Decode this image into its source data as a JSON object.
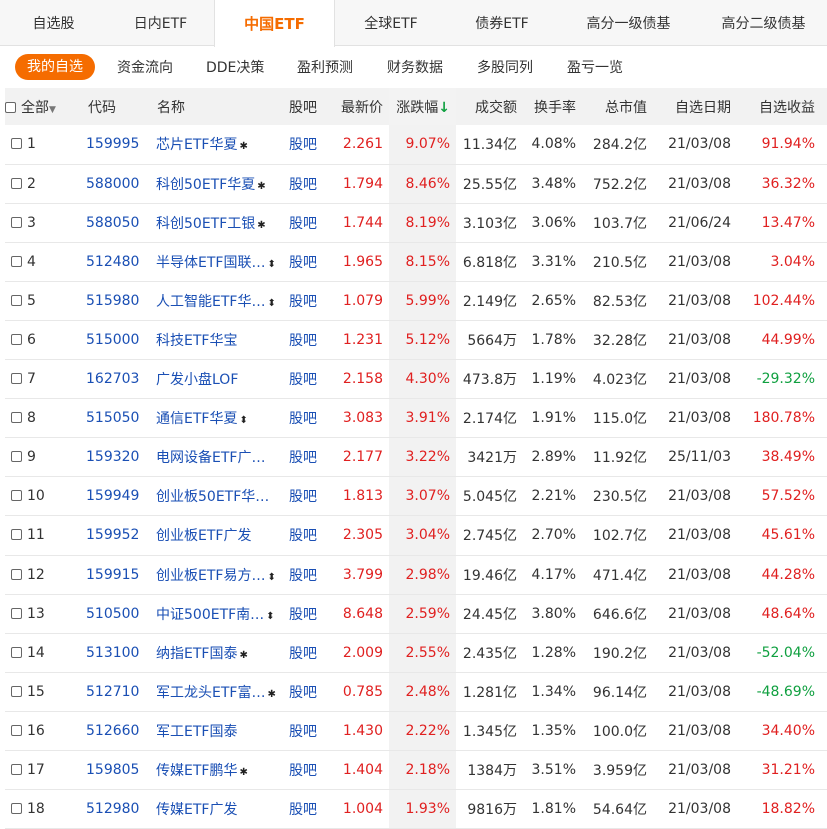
{
  "tabs": [
    {
      "label": "自选股"
    },
    {
      "label": "日内ETF"
    },
    {
      "label": "中国ETF"
    },
    {
      "label": "全球ETF"
    },
    {
      "label": "债券ETF"
    },
    {
      "label": "高分一级债基"
    },
    {
      "label": "高分二级债基"
    }
  ],
  "active_tab": "中国ETF",
  "subnav": [
    {
      "label": "我的自选"
    },
    {
      "label": "资金流向"
    },
    {
      "label": "DDE决策"
    },
    {
      "label": "盈利预测"
    },
    {
      "label": "财务数据"
    },
    {
      "label": "多股同列"
    },
    {
      "label": "盈亏一览"
    }
  ],
  "header": {
    "all": "全部",
    "all_caret": "▼",
    "code": "代码",
    "name": "名称",
    "bar": "股吧",
    "price": "最新价",
    "change": "涨跌幅",
    "sort_arrow": "↓",
    "turnover": "成交额",
    "rate": "换手率",
    "cap": "总市值",
    "date": "自选日期",
    "gain": "自选收益"
  },
  "rows": [
    {
      "idx": "1",
      "code": "159995",
      "name": "芯片ETF华夏",
      "mark": "✱",
      "bar": "股吧",
      "price": "2.261",
      "change": "9.07%",
      "turnover": "11.34亿",
      "rate": "4.08%",
      "cap": "284.2亿",
      "date": "21/03/08",
      "gain": "91.94%",
      "gain_dir": "up"
    },
    {
      "idx": "2",
      "code": "588000",
      "name": "科创50ETF华夏",
      "mark": "✱",
      "bar": "股吧",
      "price": "1.794",
      "change": "8.46%",
      "turnover": "25.55亿",
      "rate": "3.48%",
      "cap": "752.2亿",
      "date": "21/03/08",
      "gain": "36.32%",
      "gain_dir": "up"
    },
    {
      "idx": "3",
      "code": "588050",
      "name": "科创50ETF工银",
      "mark": "✱",
      "bar": "股吧",
      "price": "1.744",
      "change": "8.19%",
      "turnover": "3.103亿",
      "rate": "3.06%",
      "cap": "103.7亿",
      "date": "21/06/24",
      "gain": "13.47%",
      "gain_dir": "up"
    },
    {
      "idx": "4",
      "code": "512480",
      "name": "半导体ETF国联…",
      "mark": "⬍",
      "bar": "股吧",
      "price": "1.965",
      "change": "8.15%",
      "turnover": "6.818亿",
      "rate": "3.31%",
      "cap": "210.5亿",
      "date": "21/03/08",
      "gain": "3.04%",
      "gain_dir": "up"
    },
    {
      "idx": "5",
      "code": "515980",
      "name": "人工智能ETF华…",
      "mark": "⬍",
      "bar": "股吧",
      "price": "1.079",
      "change": "5.99%",
      "turnover": "2.149亿",
      "rate": "2.65%",
      "cap": "82.53亿",
      "date": "21/03/08",
      "gain": "102.44%",
      "gain_dir": "up"
    },
    {
      "idx": "6",
      "code": "515000",
      "name": "科技ETF华宝",
      "mark": "",
      "bar": "股吧",
      "price": "1.231",
      "change": "5.12%",
      "turnover": "5664万",
      "rate": "1.78%",
      "cap": "32.28亿",
      "date": "21/03/08",
      "gain": "44.99%",
      "gain_dir": "up"
    },
    {
      "idx": "7",
      "code": "162703",
      "name": "广发小盘LOF",
      "mark": "",
      "bar": "股吧",
      "price": "2.158",
      "change": "4.30%",
      "turnover": "473.8万",
      "rate": "1.19%",
      "cap": "4.023亿",
      "date": "21/03/08",
      "gain": "-29.32%",
      "gain_dir": "down"
    },
    {
      "idx": "8",
      "code": "515050",
      "name": "通信ETF华夏",
      "mark": "⬍",
      "bar": "股吧",
      "price": "3.083",
      "change": "3.91%",
      "turnover": "2.174亿",
      "rate": "1.91%",
      "cap": "115.0亿",
      "date": "21/03/08",
      "gain": "180.78%",
      "gain_dir": "up"
    },
    {
      "idx": "9",
      "code": "159320",
      "name": "电网设备ETF广…",
      "mark": "",
      "bar": "股吧",
      "price": "2.177",
      "change": "3.22%",
      "turnover": "3421万",
      "rate": "2.89%",
      "cap": "11.92亿",
      "date": "25/11/03",
      "gain": "38.49%",
      "gain_dir": "up"
    },
    {
      "idx": "10",
      "code": "159949",
      "name": "创业板50ETF华…",
      "mark": "",
      "bar": "股吧",
      "price": "1.813",
      "change": "3.07%",
      "turnover": "5.045亿",
      "rate": "2.21%",
      "cap": "230.5亿",
      "date": "21/03/08",
      "gain": "57.52%",
      "gain_dir": "up"
    },
    {
      "idx": "11",
      "code": "159952",
      "name": "创业板ETF广发",
      "mark": "",
      "bar": "股吧",
      "price": "2.305",
      "change": "3.04%",
      "turnover": "2.745亿",
      "rate": "2.70%",
      "cap": "102.7亿",
      "date": "21/03/08",
      "gain": "45.61%",
      "gain_dir": "up"
    },
    {
      "idx": "12",
      "code": "159915",
      "name": "创业板ETF易方…",
      "mark": "⬍",
      "bar": "股吧",
      "price": "3.799",
      "change": "2.98%",
      "turnover": "19.46亿",
      "rate": "4.17%",
      "cap": "471.4亿",
      "date": "21/03/08",
      "gain": "44.28%",
      "gain_dir": "up"
    },
    {
      "idx": "13",
      "code": "510500",
      "name": "中证500ETF南…",
      "mark": "⬍",
      "bar": "股吧",
      "price": "8.648",
      "change": "2.59%",
      "turnover": "24.45亿",
      "rate": "3.80%",
      "cap": "646.6亿",
      "date": "21/03/08",
      "gain": "48.64%",
      "gain_dir": "up"
    },
    {
      "idx": "14",
      "code": "513100",
      "name": "纳指ETF国泰",
      "mark": "✱",
      "bar": "股吧",
      "price": "2.009",
      "change": "2.55%",
      "turnover": "2.435亿",
      "rate": "1.28%",
      "cap": "190.2亿",
      "date": "21/03/08",
      "gain": "-52.04%",
      "gain_dir": "down"
    },
    {
      "idx": "15",
      "code": "512710",
      "name": "军工龙头ETF富…",
      "mark": "✱",
      "bar": "股吧",
      "price": "0.785",
      "change": "2.48%",
      "turnover": "1.281亿",
      "rate": "1.34%",
      "cap": "96.14亿",
      "date": "21/03/08",
      "gain": "-48.69%",
      "gain_dir": "down"
    },
    {
      "idx": "16",
      "code": "512660",
      "name": "军工ETF国泰",
      "mark": "",
      "bar": "股吧",
      "price": "1.430",
      "change": "2.22%",
      "turnover": "1.345亿",
      "rate": "1.35%",
      "cap": "100.0亿",
      "date": "21/03/08",
      "gain": "34.40%",
      "gain_dir": "up"
    },
    {
      "idx": "17",
      "code": "159805",
      "name": "传媒ETF鹏华",
      "mark": "✱",
      "bar": "股吧",
      "price": "1.404",
      "change": "2.18%",
      "turnover": "1384万",
      "rate": "3.51%",
      "cap": "3.959亿",
      "date": "21/03/08",
      "gain": "31.21%",
      "gain_dir": "up"
    },
    {
      "idx": "18",
      "code": "512980",
      "name": "传媒ETF广发",
      "mark": "",
      "bar": "股吧",
      "price": "1.004",
      "change": "1.93%",
      "turnover": "9816万",
      "rate": "1.81%",
      "cap": "54.64亿",
      "date": "21/03/08",
      "gain": "18.82%",
      "gain_dir": "up"
    }
  ],
  "colors": {
    "accent": "#f56c00",
    "up": "#e02020",
    "down": "#10a040",
    "link": "#1a4fb4"
  }
}
